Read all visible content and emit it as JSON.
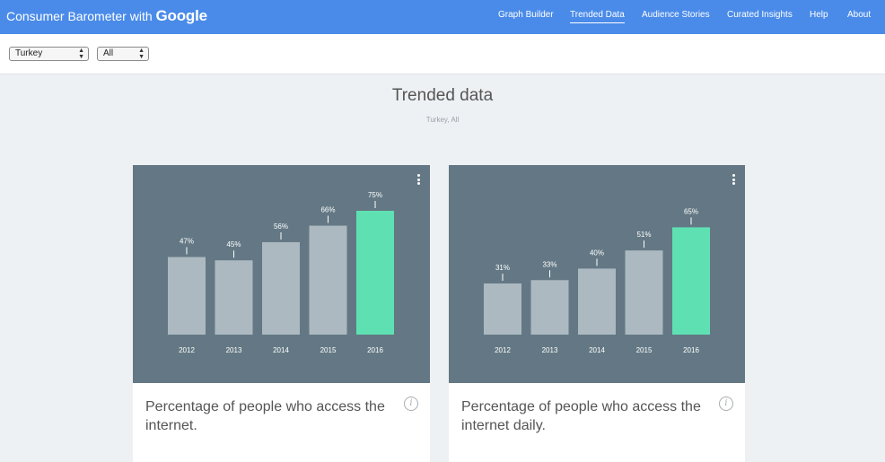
{
  "header": {
    "brand_prefix": "Consumer Barometer with",
    "brand_google": "Google",
    "nav": [
      {
        "label": "Graph Builder",
        "active": false
      },
      {
        "label": "Trended Data",
        "active": true
      },
      {
        "label": "Audience Stories",
        "active": false
      },
      {
        "label": "Curated Insights",
        "active": false
      },
      {
        "label": "Help",
        "active": false
      },
      {
        "label": "About",
        "active": false
      }
    ]
  },
  "filters": {
    "country": "Turkey",
    "audience": "All",
    "arrows_icon": "select-arrows-icon"
  },
  "page": {
    "title": "Trended data",
    "subtitle": "Turkey, All"
  },
  "colors": {
    "header_bg": "#4a8be9",
    "chart_bg": "#637884",
    "bar": "#adb9c1",
    "bar_highlight": "#5fe0b3"
  },
  "chart_data": [
    {
      "type": "bar",
      "categories": [
        "2012",
        "2013",
        "2014",
        "2015",
        "2016"
      ],
      "values": [
        47,
        45,
        56,
        66,
        75
      ],
      "value_labels": [
        "47%",
        "45%",
        "56%",
        "66%",
        "75%"
      ],
      "highlight_index": 4,
      "title": "Percentage of people who access the internet."
    },
    {
      "type": "bar",
      "categories": [
        "2012",
        "2013",
        "2014",
        "2015",
        "2016"
      ],
      "values": [
        31,
        33,
        40,
        51,
        65
      ],
      "value_labels": [
        "31%",
        "33%",
        "40%",
        "51%",
        "65%"
      ],
      "highlight_index": 4,
      "title": "Percentage of people who access the internet daily."
    }
  ]
}
